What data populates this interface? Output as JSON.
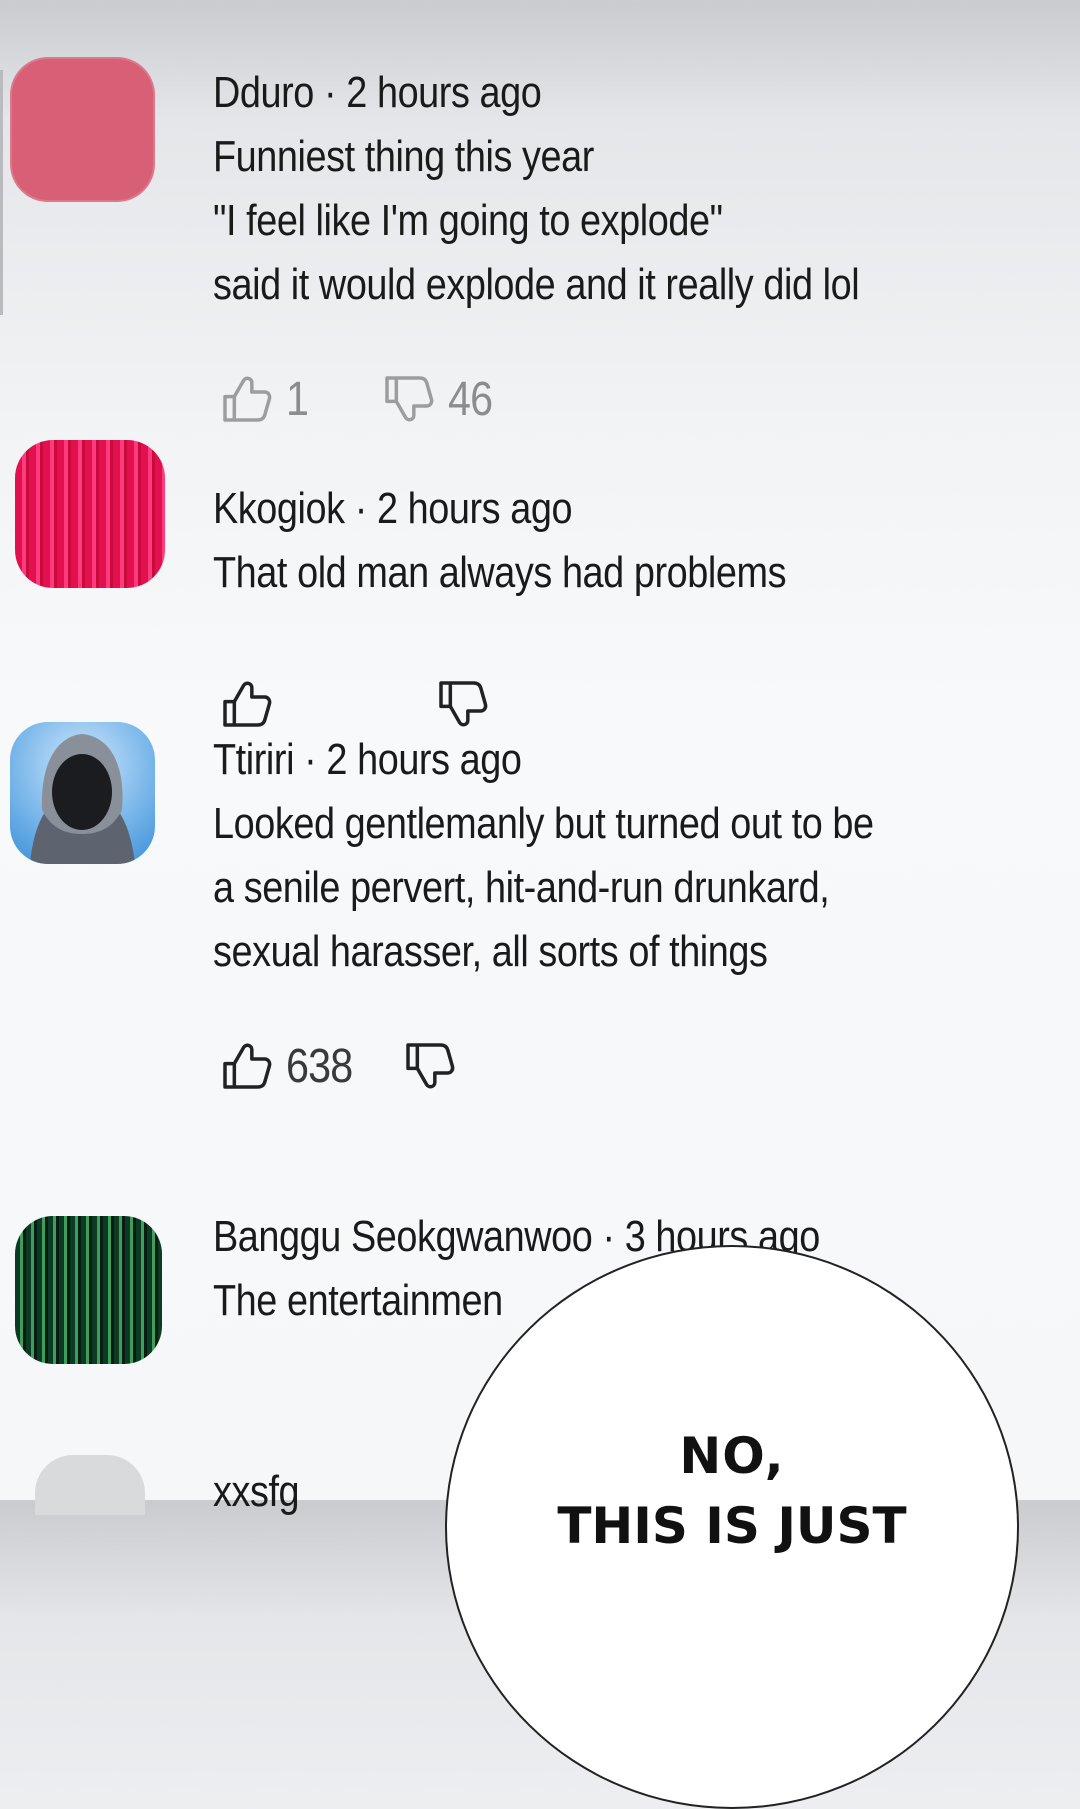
{
  "comments": [
    {
      "author": "Dduro",
      "separator": " · ",
      "time": "2 hours ago",
      "lines": [
        "Funniest thing this year",
        "\"I feel like I'm going to explode\"",
        "said it would explode and it really did lol"
      ],
      "likes": "1",
      "dislikes": "46",
      "avatar_color": "#d86076"
    },
    {
      "author": "Kkogiok",
      "separator": " · ",
      "time": "2 hours ago",
      "lines": [
        "That old man always had problems"
      ],
      "likes": "",
      "dislikes": "",
      "avatar_color": "#e2104f"
    },
    {
      "author": "Ttiriri",
      "separator": " · ",
      "time": "2 hours ago",
      "lines": [
        "Looked gentlemanly but turned out to be",
        "a senile pervert, hit-and-run drunkard,",
        "sexual harasser, all sorts of things"
      ],
      "likes": "638",
      "dislikes": "",
      "avatar_color": "#7ab7ea"
    },
    {
      "author": "Banggu Seokgwanwoo",
      "separator": " · ",
      "time": "3 hours ago",
      "lines": [
        "The entertainmen"
      ],
      "likes": "",
      "dislikes": "",
      "avatar_color": "#0c3a22"
    },
    {
      "author": "xxsfg",
      "separator": "",
      "time": "",
      "lines": [],
      "avatar_color": "#d8dadc"
    }
  ],
  "speech_bubble": {
    "line1": "NO,",
    "line2": "THIS IS JUST"
  },
  "icons": {
    "like": "thumbs-up-icon",
    "dislike": "thumbs-down-icon"
  }
}
